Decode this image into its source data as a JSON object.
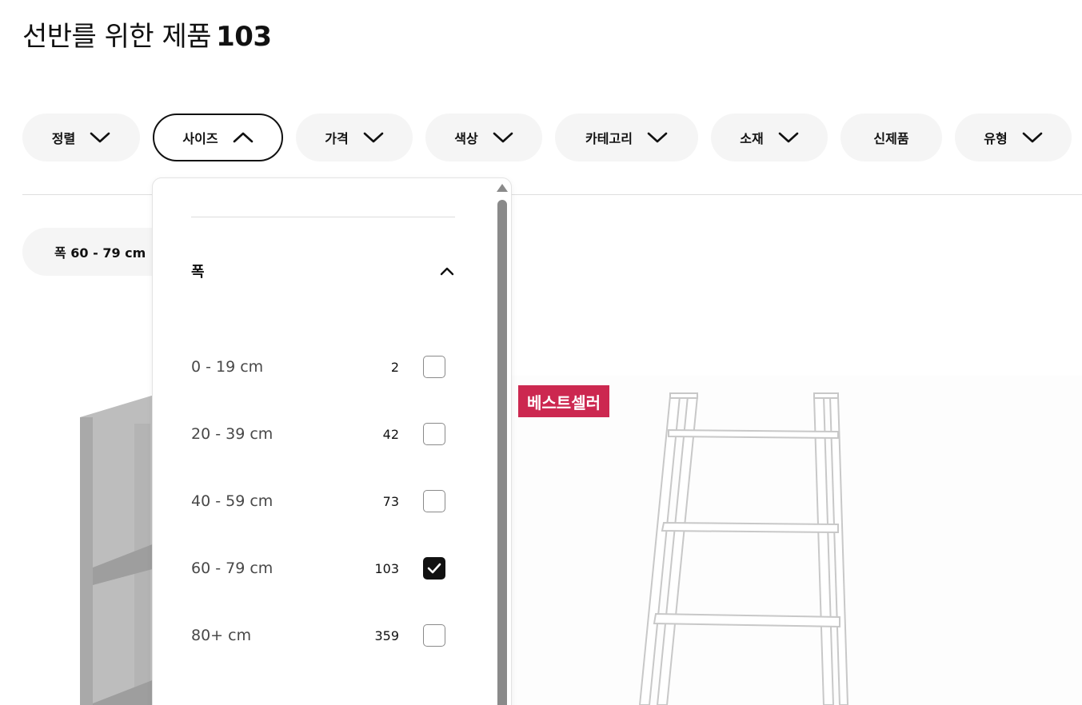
{
  "header": {
    "title": "선반를 위한 제품",
    "count": "103"
  },
  "filters": [
    {
      "label": "정렬",
      "icon": "chevron-down-icon",
      "active": false
    },
    {
      "label": "사이즈",
      "icon": "chevron-up-icon",
      "active": true
    },
    {
      "label": "가격",
      "icon": "chevron-down-icon",
      "active": false
    },
    {
      "label": "색상",
      "icon": "chevron-down-icon",
      "active": false
    },
    {
      "label": "카테고리",
      "icon": "chevron-down-icon",
      "active": false
    },
    {
      "label": "소재",
      "icon": "chevron-down-icon",
      "active": false
    },
    {
      "label": "신제품",
      "icon": null,
      "active": false
    },
    {
      "label": "유형",
      "icon": "chevron-down-icon",
      "active": false
    }
  ],
  "active_filter_chip": {
    "label": "폭 60 - 79 cm"
  },
  "dropdown": {
    "section_title": "폭",
    "section_icon": "chevron-up-icon",
    "options": [
      {
        "label": "0 - 19 cm",
        "count": "2",
        "checked": false
      },
      {
        "label": "20 - 39 cm",
        "count": "42",
        "checked": false
      },
      {
        "label": "40 - 59 cm",
        "count": "73",
        "checked": false
      },
      {
        "label": "60 - 79 cm",
        "count": "103",
        "checked": true
      },
      {
        "label": "80+ cm",
        "count": "359",
        "checked": false
      }
    ]
  },
  "product_badge": {
    "label": "베스트셀러",
    "color": "#cc2850"
  }
}
